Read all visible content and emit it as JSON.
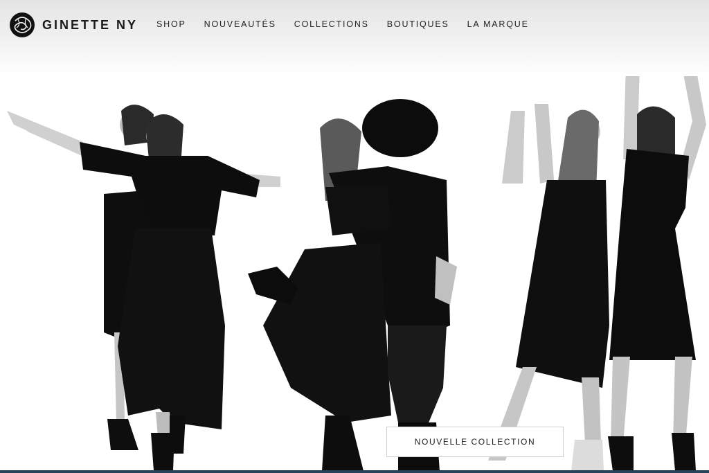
{
  "brand": {
    "name": "GINETTE NY",
    "logo_icon": "monogram-logo-icon"
  },
  "nav": {
    "items": [
      {
        "label": "SHOP"
      },
      {
        "label": "NOUVEAUTÉS"
      },
      {
        "label": "COLLECTIONS"
      },
      {
        "label": "BOUTIQUES"
      },
      {
        "label": "LA MARQUE"
      }
    ]
  },
  "hero": {
    "cta_label": "NOUVELLE COLLECTION"
  },
  "colors": {
    "text": "#1b1b1b",
    "clothing": "#0d0d0d",
    "skin": "#cfcfcf",
    "bottom_bar": "#27435a"
  }
}
